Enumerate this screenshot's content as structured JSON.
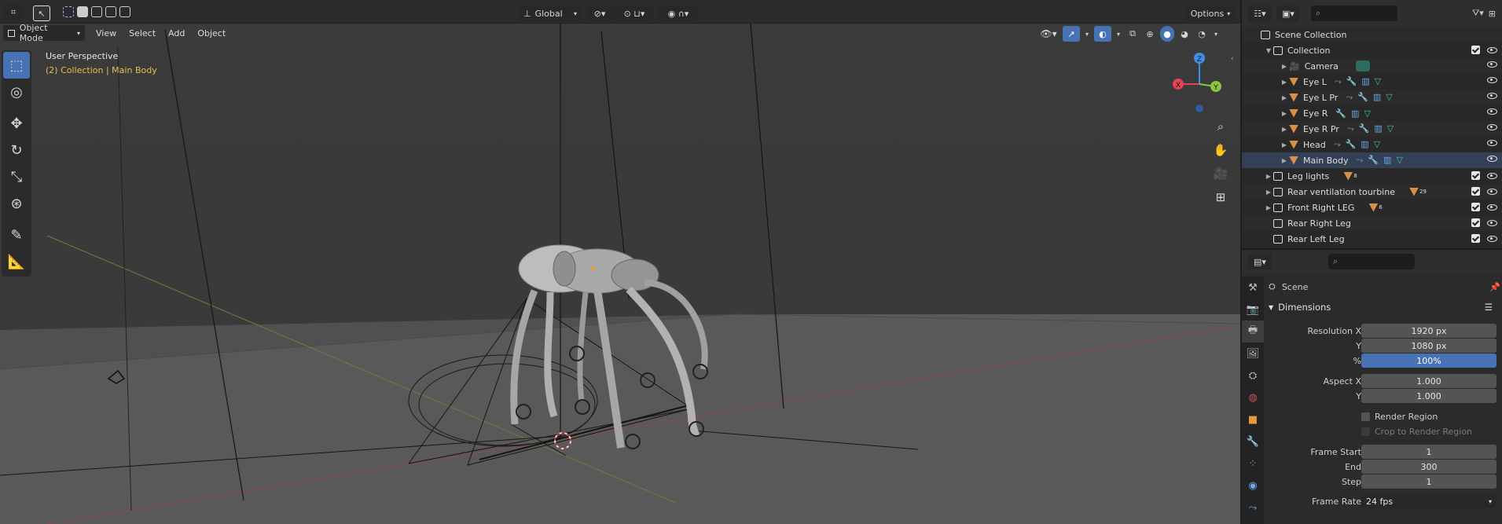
{
  "viewport": {
    "header": {
      "mode_label": "Object Mode",
      "menus": [
        "View",
        "Select",
        "Add",
        "Object"
      ],
      "orientation_label": "Global",
      "options_label": "Options"
    },
    "overlay": {
      "perspective_label": "User Perspective",
      "collection_label": "(2) Collection | Main Body"
    },
    "gizmo": {
      "x": "X",
      "y": "Y",
      "z": "Z"
    },
    "colors": {
      "accent": "#4772b3",
      "selected_text": "#e5c04a",
      "axis_x": "#e44353",
      "axis_y": "#8bc63f",
      "axis_z": "#3f8eea"
    }
  },
  "outliner": {
    "search_placeholder": "",
    "scene_collection": "Scene Collection",
    "collection": "Collection",
    "children": [
      {
        "name": "Camera",
        "type": "camera"
      },
      {
        "name": "Eye L",
        "type": "mesh"
      },
      {
        "name": "Eye L Pr",
        "type": "mesh"
      },
      {
        "name": "Eye R",
        "type": "mesh"
      },
      {
        "name": "Eye R Pr",
        "type": "mesh"
      },
      {
        "name": "Head",
        "type": "mesh"
      },
      {
        "name": "Main Body",
        "type": "mesh"
      }
    ],
    "collections": [
      {
        "name": "Leg lights",
        "badge": "8"
      },
      {
        "name": "Rear ventilation tourbine",
        "badge": "29"
      },
      {
        "name": "Front Right LEG",
        "badge": "6"
      },
      {
        "name": "Rear Right Leg",
        "badge": ""
      },
      {
        "name": "Rear Left Leg",
        "badge": ""
      }
    ]
  },
  "properties": {
    "scene_label": "Scene",
    "panel_title": "Dimensions",
    "resolution_x_label": "Resolution X",
    "resolution_x": "1920 px",
    "resolution_y_label": "Y",
    "resolution_y": "1080 px",
    "percent_label": "%",
    "percent": "100%",
    "aspect_x_label": "Aspect X",
    "aspect_x": "1.000",
    "aspect_y_label": "Y",
    "aspect_y": "1.000",
    "render_region_label": "Render Region",
    "crop_label": "Crop to Render Region",
    "frame_start_label": "Frame Start",
    "frame_start": "1",
    "end_label": "End",
    "end": "300",
    "step_label": "Step",
    "step": "1",
    "frame_rate_label": "Frame Rate",
    "frame_rate": "24 fps"
  }
}
